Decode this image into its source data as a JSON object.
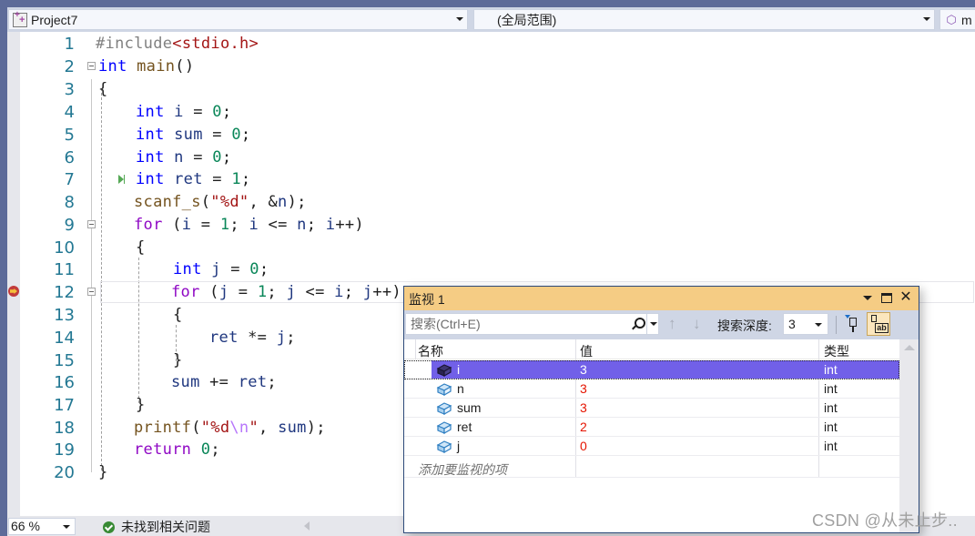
{
  "navbar": {
    "project": "Project7",
    "scope": "(全局范围)",
    "member": "m"
  },
  "editor": {
    "lines": [
      {
        "n": "1"
      },
      {
        "n": "2"
      },
      {
        "n": "3"
      },
      {
        "n": "4"
      },
      {
        "n": "5"
      },
      {
        "n": "6"
      },
      {
        "n": "7"
      },
      {
        "n": "8"
      },
      {
        "n": "9"
      },
      {
        "n": "10"
      },
      {
        "n": "11"
      },
      {
        "n": "12"
      },
      {
        "n": "13"
      },
      {
        "n": "14"
      },
      {
        "n": "15"
      },
      {
        "n": "16"
      },
      {
        "n": "17"
      },
      {
        "n": "18"
      },
      {
        "n": "19"
      },
      {
        "n": "20"
      }
    ],
    "code": {
      "l1_pp": "#include",
      "l1_hdr": "<stdio.h>",
      "l2_kw": "int",
      "l2_fn": " main",
      "l2_rest": "()",
      "l3": "{",
      "l4_kw": "int",
      "l4_var": " i",
      "l4_op": " = ",
      "l4_num": "0",
      "l4_end": ";",
      "l5_kw": "int",
      "l5_var": " sum",
      "l5_op": " = ",
      "l5_num": "0",
      "l5_end": ";",
      "l6_kw": "int",
      "l6_var": " n",
      "l6_op": " = ",
      "l6_num": "0",
      "l6_end": ";",
      "l7_kw": "int",
      "l7_var": " ret",
      "l7_op": " = ",
      "l7_num": "1",
      "l7_end": ";",
      "l8_fn": "scanf_s",
      "l8_p1": "(",
      "l8_str": "\"%d\"",
      "l8_p2": ", &",
      "l8_var": "n",
      "l8_end": ");",
      "l9_ctl": "for",
      "l9_a": " (",
      "l9_v1": "i",
      "l9_b": " = ",
      "l9_n1": "1",
      "l9_c": "; ",
      "l9_v2": "i",
      "l9_d": " <= ",
      "l9_v3": "n",
      "l9_e": "; ",
      "l9_v4": "i",
      "l9_f": "++)",
      "l10": "{",
      "l11_kw": "int",
      "l11_var": " j",
      "l11_op": " = ",
      "l11_num": "0",
      "l11_end": ";",
      "l12_ctl": "for",
      "l12_a": " (",
      "l12_v1": "j",
      "l12_b": " = ",
      "l12_n1": "1",
      "l12_c": "; ",
      "l12_v2": "j",
      "l12_d": " <= ",
      "l12_v3": "i",
      "l12_e": "; ",
      "l12_v4": "j",
      "l12_f": "++)",
      "l13": "{",
      "l14_var": "ret",
      "l14_op": " *= ",
      "l14_var2": "j",
      "l14_end": ";",
      "l15": "}",
      "l16_var": "sum",
      "l16_op": " += ",
      "l16_var2": "ret",
      "l16_end": ";",
      "l17": "}",
      "l18_fn": "printf",
      "l18_p1": "(",
      "l18_str1": "\"%d",
      "l18_esc": "\\n",
      "l18_str2": "\"",
      "l18_p2": ", ",
      "l18_var": "sum",
      "l18_end": ");",
      "l19_ctl": "return",
      "l19_sp": " ",
      "l19_num": "0",
      "l19_end": ";",
      "l20": "}"
    }
  },
  "statusbar": {
    "zoom": "66 %",
    "status": "未找到相关问题"
  },
  "watch": {
    "title": "监视 1",
    "search_placeholder": "搜索(Ctrl+E)",
    "depth_label": "搜索深度:",
    "depth_value": "3",
    "columns": {
      "name": "名称",
      "value": "值",
      "type": "类型"
    },
    "rows": [
      {
        "name": "i",
        "value": "3",
        "type": "int",
        "selected": true
      },
      {
        "name": "n",
        "value": "3",
        "type": "int"
      },
      {
        "name": "sum",
        "value": "3",
        "type": "int"
      },
      {
        "name": "ret",
        "value": "2",
        "type": "int"
      },
      {
        "name": "j",
        "value": "0",
        "type": "int"
      }
    ],
    "add_placeholder": "添加要监视的项",
    "selection_color": "#7160e8",
    "changed_value_color": "#e51400"
  },
  "watermark": "CSDN @从未止步.."
}
